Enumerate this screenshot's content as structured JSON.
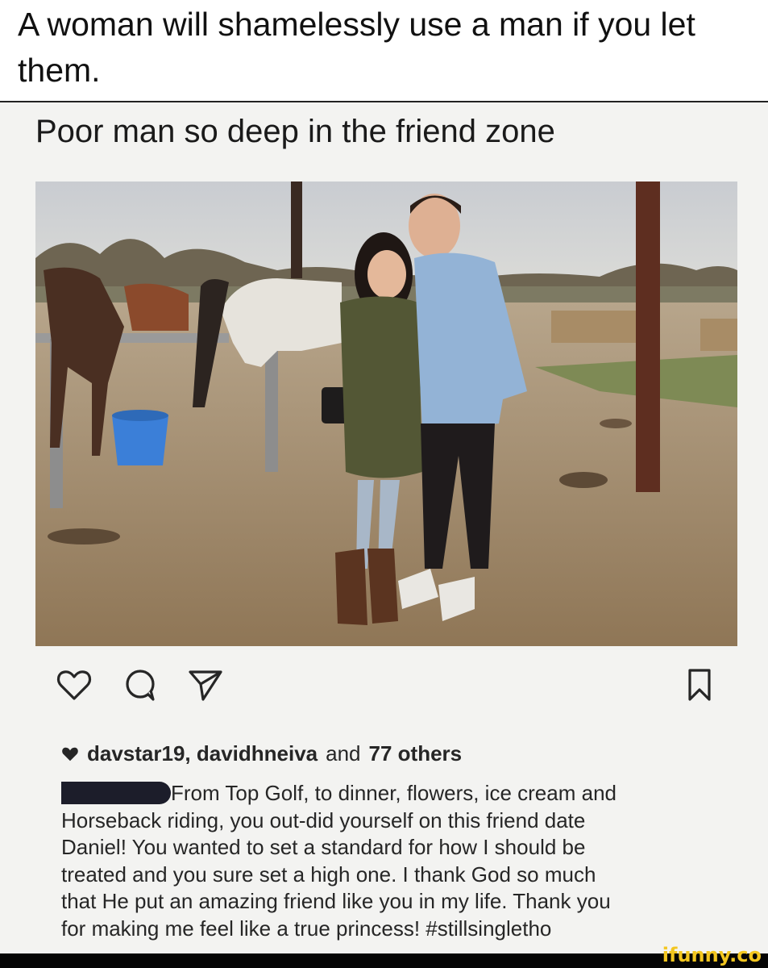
{
  "meme": {
    "top_caption": "A woman will shamelessly use a man if you let them."
  },
  "post": {
    "caption": "Poor man so deep in the friend zone",
    "photo": {
      "description_icon": "photo-horses-couple"
    },
    "actions": {
      "like_icon": "heart-outline-icon",
      "comment_icon": "comment-bubble-icon",
      "share_icon": "paper-plane-icon",
      "save_icon": "bookmark-icon"
    },
    "likes": {
      "users": "davstar19, davidhneiva",
      "and_text": "and",
      "others": "77 others"
    },
    "body": {
      "line1": "From Top Golf, to dinner, flowers, ice cream and",
      "line2": "Horseback riding, you out-did yourself on this friend date",
      "line3": "Daniel! You wanted to set a standard for how I should be",
      "line4": "treated and you sure set a high one. I thank God so much",
      "line5": "that He put an amazing friend like you in my life. Thank you",
      "line6": "for making me feel like a true princess! #stillsingletho"
    }
  },
  "watermark": {
    "text": "ifunny.co",
    "color": "#f3c61f"
  }
}
